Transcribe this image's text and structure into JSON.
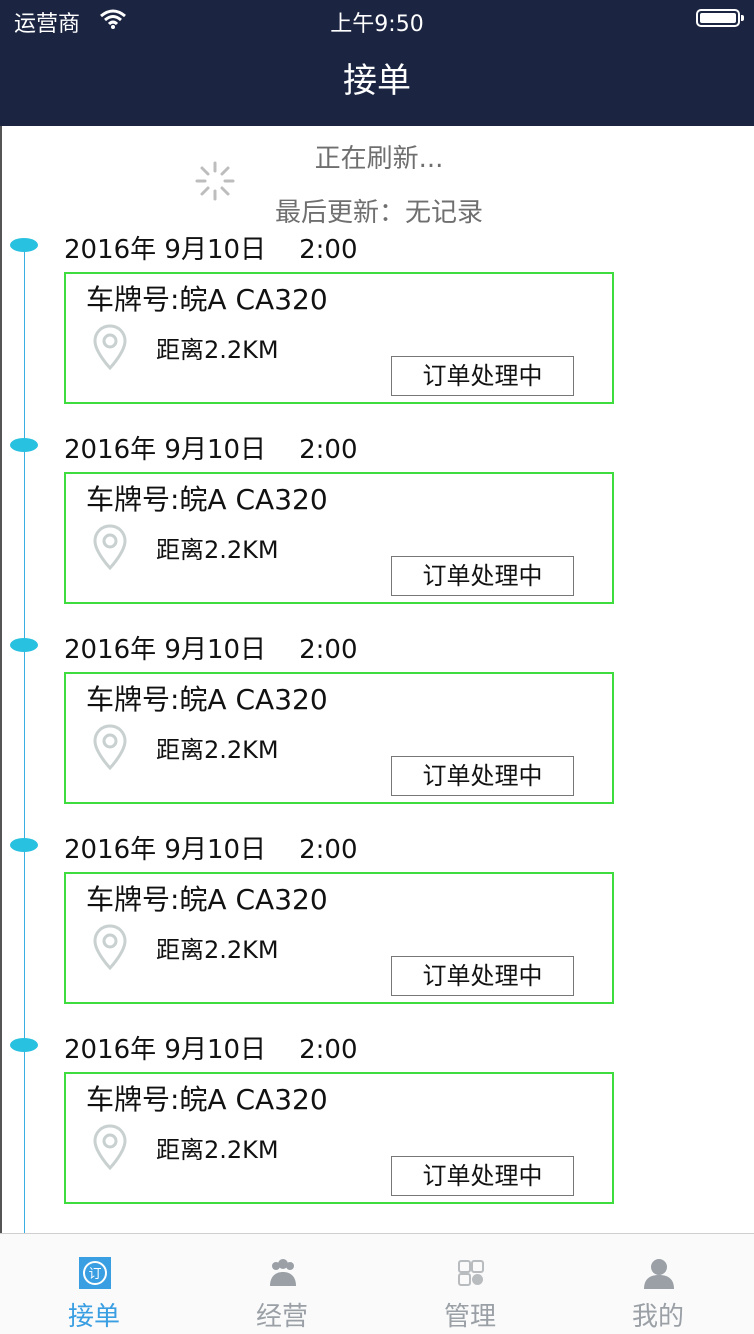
{
  "status_bar": {
    "carrier": "运营商",
    "time": "上午9:50"
  },
  "nav": {
    "title": "接单"
  },
  "refresh": {
    "title": "正在刷新...",
    "last_update": "最后更新：无记录"
  },
  "orders": [
    {
      "date": "2016年 9月10日    2:00",
      "plate": "车牌号:皖A CA320",
      "distance": "距离2.2KM",
      "status": "订单处理中"
    },
    {
      "date": "2016年 9月10日    2:00",
      "plate": "车牌号:皖A CA320",
      "distance": "距离2.2KM",
      "status": "订单处理中"
    },
    {
      "date": "2016年 9月10日    2:00",
      "plate": "车牌号:皖A CA320",
      "distance": "距离2.2KM",
      "status": "订单处理中"
    },
    {
      "date": "2016年 9月10日    2:00",
      "plate": "车牌号:皖A CA320",
      "distance": "距离2.2KM",
      "status": "订单处理中"
    },
    {
      "date": "2016年 9月10日    2:00",
      "plate": "车牌号:皖A CA320",
      "distance": "距离2.2KM",
      "status": "订单处理中"
    }
  ],
  "tabs": [
    {
      "label": "接单",
      "icon": "order-icon",
      "active": true
    },
    {
      "label": "经营",
      "icon": "people-icon",
      "active": false
    },
    {
      "label": "管理",
      "icon": "grid-icon",
      "active": false
    },
    {
      "label": "我的",
      "icon": "user-icon",
      "active": false
    }
  ],
  "colors": {
    "nav_bg": "#1b2541",
    "timeline": "#39aee0",
    "dot": "#29c1e0",
    "card_border": "#3fdc3f",
    "tab_active": "#3a9ee2",
    "tab_inactive": "#9aa0a6"
  }
}
